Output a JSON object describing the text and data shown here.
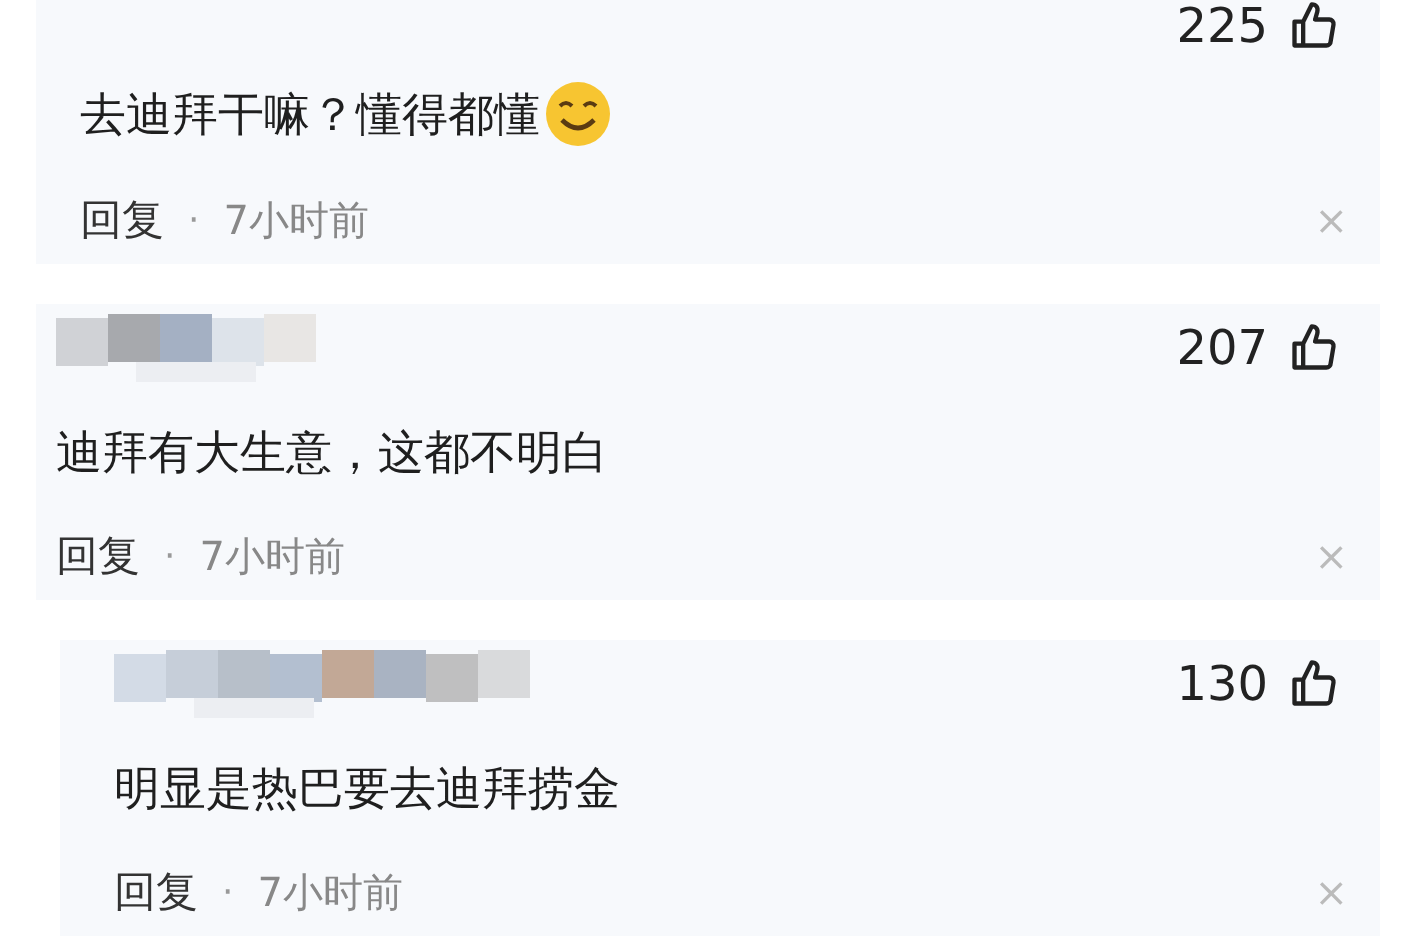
{
  "comments": [
    {
      "likes": "225",
      "text": "去迪拜干嘛？懂得都懂",
      "emoji": true,
      "reply": "回复",
      "dot": "·",
      "time": "7小时前",
      "close": "×"
    },
    {
      "likes": "207",
      "text": "迪拜有大生意，这都不明白",
      "emoji": false,
      "reply": "回复",
      "dot": "·",
      "time": "7小时前",
      "close": "×"
    },
    {
      "likes": "130",
      "text": "明显是热巴要去迪拜捞金",
      "emoji": false,
      "reply": "回复",
      "dot": "·",
      "time": "7小时前",
      "close": "×"
    }
  ]
}
